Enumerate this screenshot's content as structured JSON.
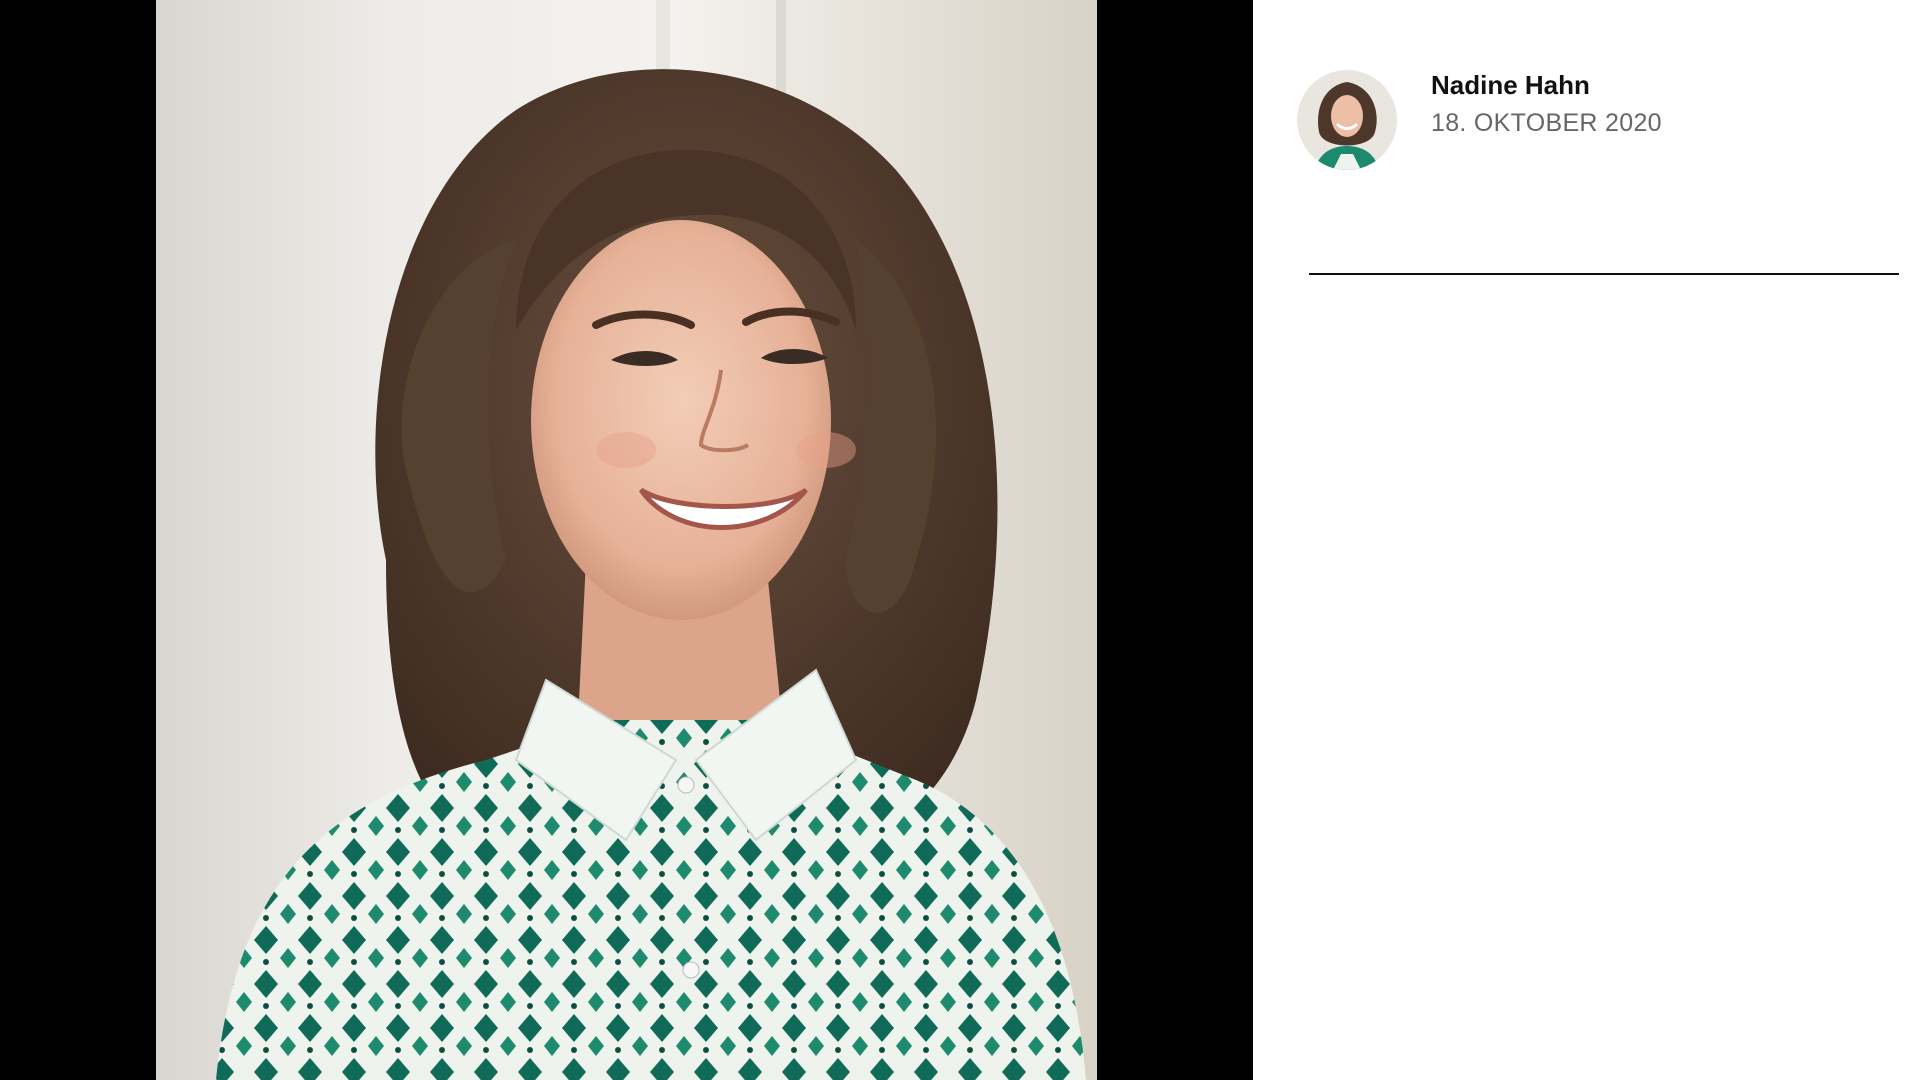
{
  "post": {
    "author_name": "Nadine Hahn",
    "date": "18. OKTOBER 2020"
  },
  "colors": {
    "stage_background": "#000000",
    "panel_background": "#ffffff",
    "name_color": "#111111",
    "date_color": "#666666"
  },
  "icons": {
    "avatar": "portrait-avatar",
    "photo": "portrait-photo"
  }
}
